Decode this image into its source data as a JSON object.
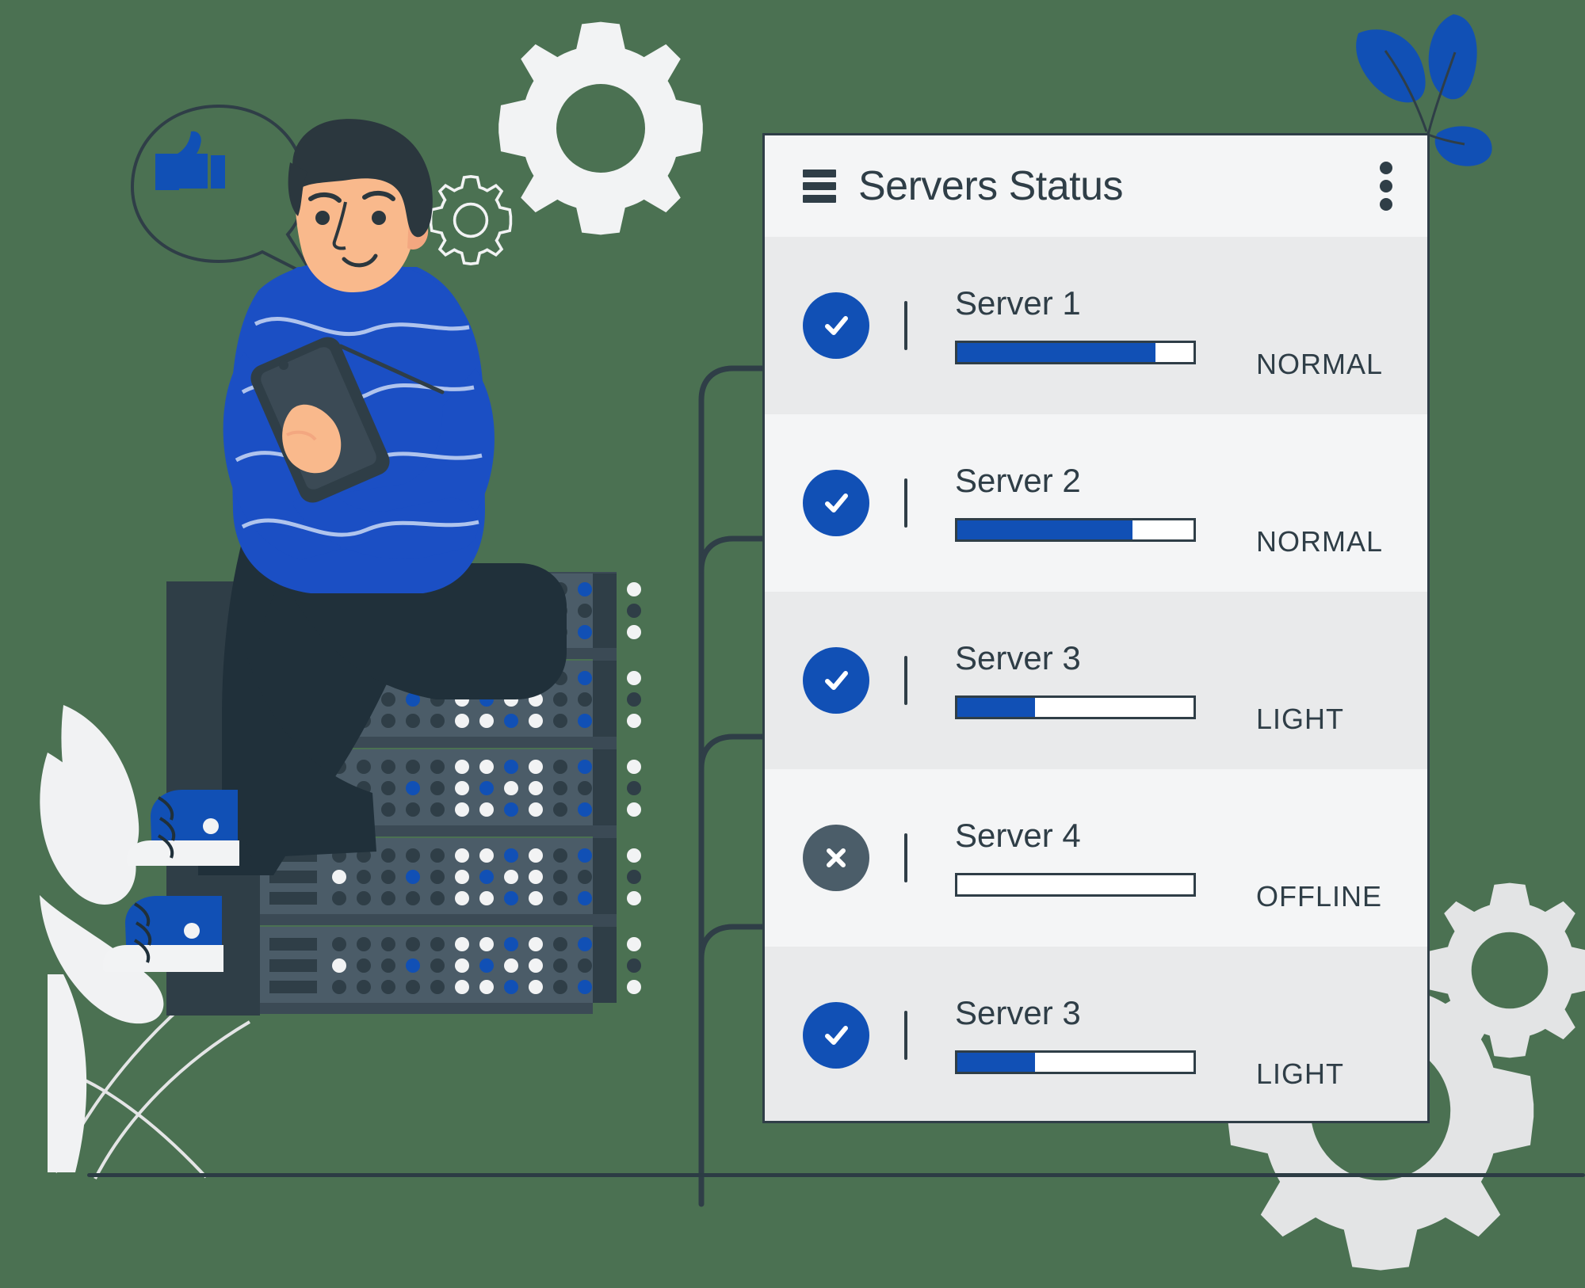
{
  "theme": {
    "background": "#4b7152",
    "panel_bg": "#f4f5f6",
    "panel_row_alt": "#e9eaeb",
    "accent_blue": "#1150b5",
    "ink": "#2f3e47",
    "offline_gray": "#4b5d69",
    "gear_gray": "#e3e4e5",
    "skin": "#f9b98c",
    "hair": "#2b373e",
    "pants": "#20303a",
    "server_body": "#4b5c68",
    "server_dark": "#2f3e47"
  },
  "panel": {
    "title": "Servers Status",
    "menu_icon": "hamburger-icon",
    "overflow_icon": "kebab-menu-icon",
    "rows": [
      {
        "name": "Server 1",
        "status": "NORMAL",
        "percent": 84,
        "state": "ok",
        "icon": "check-icon",
        "shade": "alt"
      },
      {
        "name": "Server 2",
        "status": "NORMAL",
        "percent": 74,
        "state": "ok",
        "icon": "check-icon",
        "shade": "plain"
      },
      {
        "name": "Server 3",
        "status": "LIGHT",
        "percent": 33,
        "state": "ok",
        "icon": "check-icon",
        "shade": "alt"
      },
      {
        "name": "Server 4",
        "status": "OFFLINE",
        "percent": 0,
        "state": "offline",
        "icon": "close-icon",
        "shade": "plain"
      },
      {
        "name": "Server 3",
        "status": "LIGHT",
        "percent": 33,
        "state": "ok",
        "icon": "check-icon",
        "shade": "alt"
      }
    ]
  },
  "illustration": {
    "character": "person-sitting-on-server-stack",
    "tablet": "tablet-device",
    "speech_bubble_icon": "thumbs-up-icon",
    "plant": "blue-leaf-plant",
    "gears": [
      "gear-large",
      "gear-small",
      "gear-bottom-large",
      "gear-bottom-small"
    ],
    "server_units": 5,
    "cables": 4
  }
}
